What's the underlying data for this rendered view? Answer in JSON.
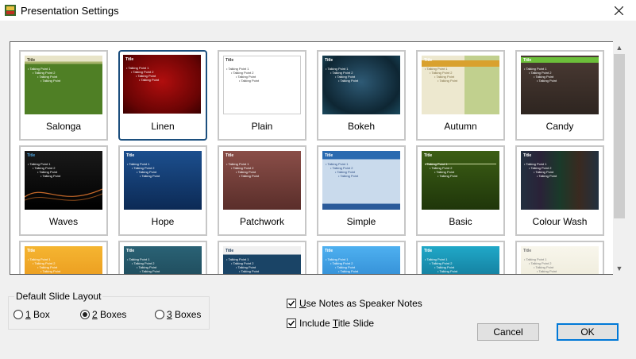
{
  "window": {
    "title": "Presentation Settings"
  },
  "templates": [
    {
      "name": "Salonga",
      "bg": "#4a7a2a",
      "stops": [
        "#e8e4c8",
        "#a7b36a",
        "#4f7f25",
        "#5b8a34"
      ],
      "title_color": "#3a3a20",
      "text_color": "#ffffff",
      "style": "salonga"
    },
    {
      "name": "Linen",
      "bg": "#7a0a0a",
      "stops": [
        "#b10e0e",
        "#6a0404",
        "#3a0000"
      ],
      "title_color": "#ffffff",
      "text_color": "#ffffff",
      "style": "radial",
      "selected": true
    },
    {
      "name": "Plain",
      "bg": "#ffffff",
      "stops": [
        "#ffffff",
        "#ffffff"
      ],
      "title_color": "#333333",
      "text_color": "#333333",
      "style": "plain"
    },
    {
      "name": "Bokeh",
      "bg": "#1a3b4e",
      "stops": [
        "#2e5a75",
        "#0e2633",
        "#1b4a5e"
      ],
      "title_color": "#ffffff",
      "text_color": "#ffffff",
      "style": "radial"
    },
    {
      "name": "Autumn",
      "bg": "#e9e4c8",
      "stops": [
        "#ede8cf",
        "#c1d08e"
      ],
      "title_color": "#ffffff",
      "text_color": "#7a6a40",
      "style": "autumn"
    },
    {
      "name": "Candy",
      "bg": "#3a2e2a",
      "stops": [
        "#4a3a33",
        "#2e2520"
      ],
      "title_color": "#ffffff",
      "text_color": "#ffffff",
      "style": "candy"
    },
    {
      "name": "Waves",
      "bg": "#111111",
      "stops": [
        "#1a1a1a",
        "#000000"
      ],
      "title_color": "#4ea6e0",
      "text_color": "#ffffff",
      "style": "waves"
    },
    {
      "name": "Hope",
      "bg": "#143a6e",
      "stops": [
        "#1c4f8e",
        "#0c2a55"
      ],
      "title_color": "#ffffff",
      "text_color": "#ffffff",
      "style": "hope"
    },
    {
      "name": "Patchwork",
      "bg": "#6e3a36",
      "stops": [
        "#8a4e48",
        "#5a2e2a"
      ],
      "title_color": "#ffffff",
      "text_color": "#ffffff",
      "style": "patch"
    },
    {
      "name": "Simple",
      "bg": "#b7cde3",
      "stops": [
        "#c9daec",
        "#a7bfd8"
      ],
      "title_color": "#ffffff",
      "text_color": "#2a4a80",
      "style": "simple"
    },
    {
      "name": "Basic",
      "bg": "#2d4a0e",
      "stops": [
        "#3c5e15",
        "#1f360a"
      ],
      "title_color": "#ffffff",
      "text_color": "#ffffff",
      "style": "basic"
    },
    {
      "name": "Colour Wash",
      "bg": "#1c2230",
      "stops": [
        "#22303f",
        "#2a2238",
        "#1a3a2a",
        "#3a2a20"
      ],
      "title_color": "#ffffff",
      "text_color": "#ffffff",
      "style": "wash"
    },
    {
      "name": "",
      "bg": "#f0a020",
      "stops": [
        "#f5b531",
        "#e38a12"
      ],
      "title_color": "#ffffff",
      "text_color": "#ffffff",
      "style": "orange"
    },
    {
      "name": "",
      "bg": "#1f4a5c",
      "stops": [
        "#2a6275",
        "#163a48"
      ],
      "title_color": "#ffffff",
      "text_color": "#ffffff",
      "style": "teal"
    },
    {
      "name": "",
      "bg": "#143a5a",
      "stops": [
        "#f0f0f0",
        "#1a4466",
        "#0e2a44"
      ],
      "title_color": "#1a3a5a",
      "text_color": "#ffffff",
      "style": "navy"
    },
    {
      "name": "",
      "bg": "#2b8fd8",
      "stops": [
        "#4eb0f0",
        "#1e74c0"
      ],
      "title_color": "#ffffff",
      "text_color": "#ffffff",
      "style": "blue"
    },
    {
      "name": "",
      "bg": "#0e7c9c",
      "stops": [
        "#20a8c8",
        "#0a5a7a"
      ],
      "title_color": "#ffffff",
      "text_color": "#ffffff",
      "style": "cyan"
    },
    {
      "name": "",
      "bg": "#f4f1e4",
      "stops": [
        "#f8f6ec",
        "#e8e4cf"
      ],
      "title_color": "#777777",
      "text_color": "#777777",
      "style": "cream"
    }
  ],
  "thumb_text": {
    "title": "Title",
    "l1": "Talking Point 1",
    "l2": "Talking Point 2",
    "l3": "Talking Point",
    "l4": "Talking Point"
  },
  "layout_group": {
    "legend": "Default Slide Layout",
    "options": [
      {
        "label": "1 Box",
        "mnemonic": "1",
        "rest": " Box",
        "checked": false
      },
      {
        "label": "2 Boxes",
        "mnemonic": "2",
        "rest": " Boxes",
        "checked": true
      },
      {
        "label": "3 Boxes",
        "mnemonic": "3",
        "rest": " Boxes",
        "checked": false
      }
    ]
  },
  "options": {
    "speaker_notes": {
      "pre": "",
      "mnemonic": "U",
      "post": "se Notes as Speaker Notes",
      "checked": true
    },
    "title_slide": {
      "pre": "Include ",
      "mnemonic": "T",
      "post": "itle Slide",
      "checked": true
    }
  },
  "buttons": {
    "cancel": "Cancel",
    "ok": "OK"
  }
}
